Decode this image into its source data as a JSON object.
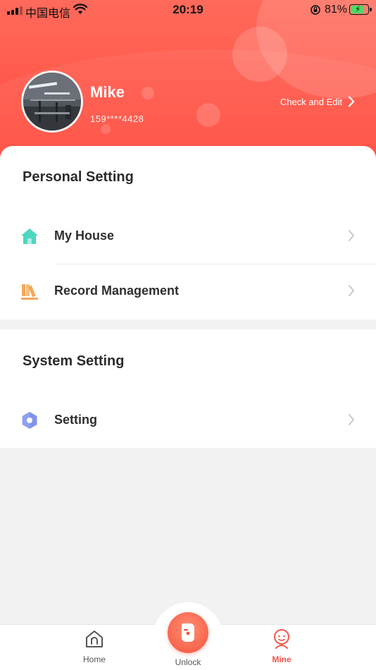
{
  "status_bar": {
    "carrier": "中国电信",
    "time": "20:19",
    "battery_percent": "81%",
    "battery_level": 0.81,
    "icons": [
      "signal-icon",
      "wifi-icon",
      "orientation-lock-icon",
      "battery-charging-icon"
    ]
  },
  "profile": {
    "name": "Mike",
    "phone": "159****4428",
    "check_edit_label": "Check and Edit"
  },
  "personal_setting": {
    "title": "Personal Setting",
    "items": [
      {
        "label": "My House",
        "icon": "house-icon",
        "icon_color": "#4dd6c1"
      },
      {
        "label": "Record Management",
        "icon": "books-icon",
        "icon_color": "#f6a75a"
      }
    ]
  },
  "system_setting": {
    "title": "System Setting",
    "items": [
      {
        "label": "Setting",
        "icon": "hexagon-gear-icon",
        "icon_color": "#7f93ee"
      }
    ]
  },
  "tabbar": {
    "tabs": [
      {
        "label": "Home",
        "icon": "home-icon",
        "active": false
      },
      {
        "label": "Unlock",
        "icon": "lock-icon",
        "active": false
      },
      {
        "label": "Mine",
        "icon": "person-icon",
        "active": true
      }
    ],
    "active_color": "#f4564a"
  },
  "colors": {
    "header": "#ff5545",
    "accent": "#f4564a",
    "page_bg": "#f2f2f2"
  }
}
